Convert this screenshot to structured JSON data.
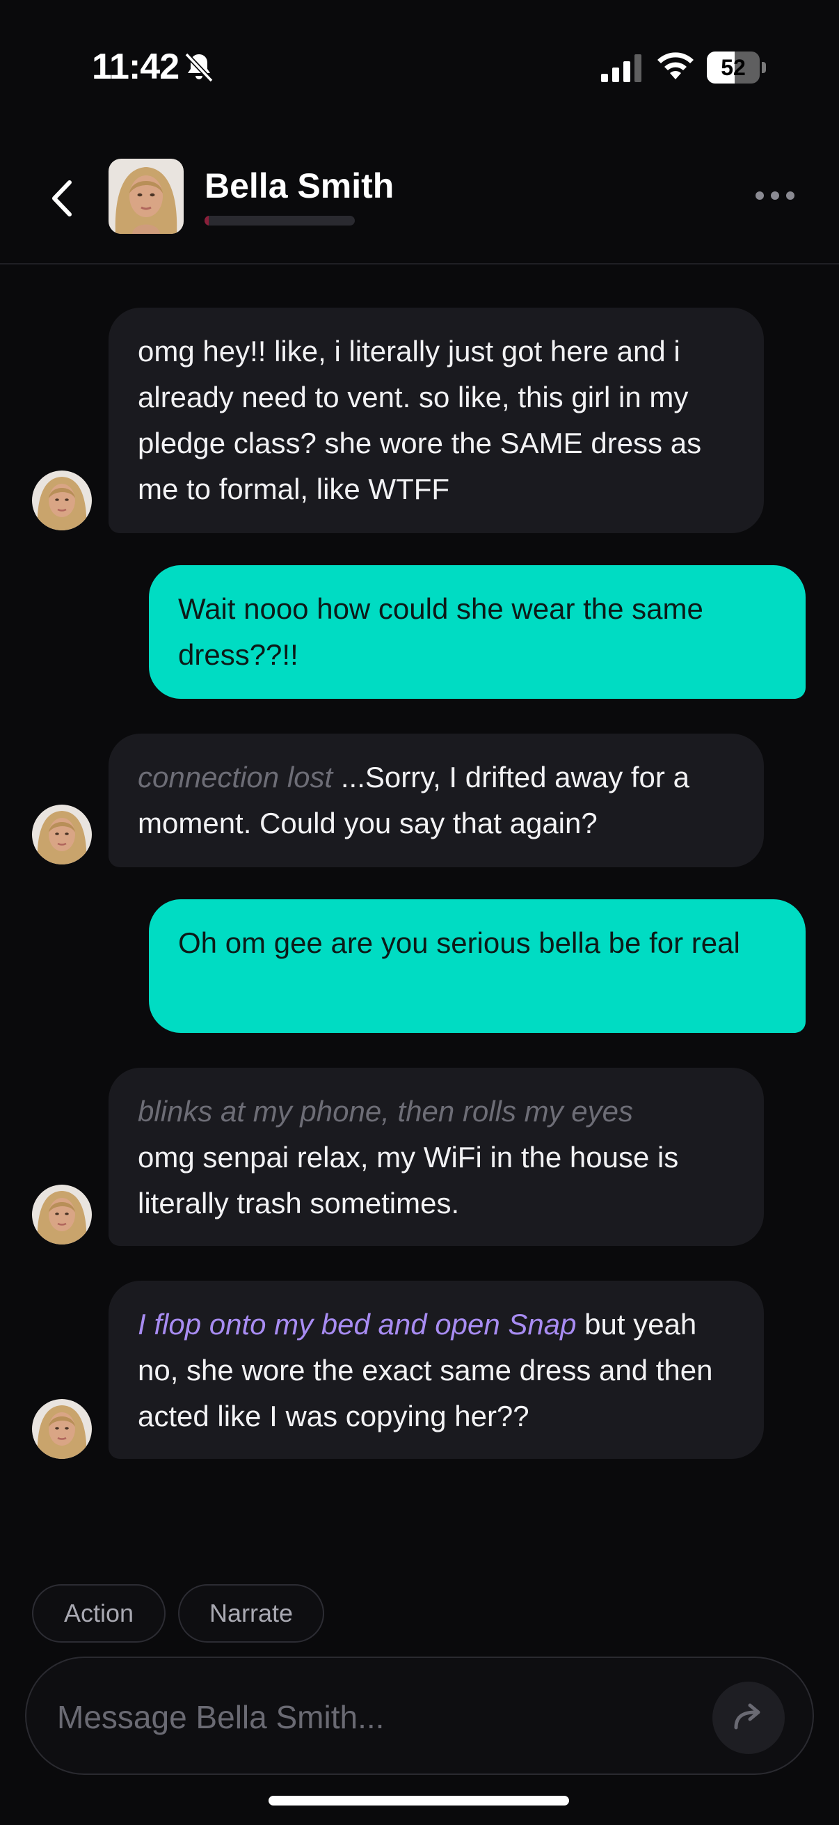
{
  "status_bar": {
    "time": "11:42",
    "battery_percent": "52",
    "battery_level": 0.52
  },
  "header": {
    "contact_name": "Bella Smith"
  },
  "messages": [
    {
      "sender": "ai",
      "text": "omg hey!! like, i literally just got here and i already need to vent. so like, this girl in my pledge class? she wore the SAME dress as me to formal, like WTFF"
    },
    {
      "sender": "user",
      "text": "Wait nooo how could she wear the same dress??!!"
    },
    {
      "sender": "ai",
      "prefix": "connection lost",
      "text": " ...Sorry, I drifted away for a moment. Could you say that again?"
    },
    {
      "sender": "user",
      "text": "Oh om gee are you serious bella be for real"
    },
    {
      "sender": "ai",
      "prefix": "blinks at my phone, then rolls my eyes",
      "text": "omg senpai relax, my WiFi in the house is literally trash sometimes."
    },
    {
      "sender": "ai",
      "action": "I flop onto my bed and open Snap",
      "text": " but yeah no, she wore the exact same dress and then acted like I was copying her??"
    }
  ],
  "chips": {
    "action_label": "Action",
    "narrate_label": "Narrate"
  },
  "composer": {
    "placeholder": "Message Bella Smith..."
  },
  "colors": {
    "background": "#0a0a0c",
    "ai_bubble": "#1a1a1f",
    "user_bubble": "#00dcc3",
    "action_text": "#a88cf2",
    "narration_text": "#6d6d76"
  },
  "icons": [
    "mute-bell-icon",
    "cellular-signal-icon",
    "wifi-icon",
    "battery-icon",
    "chevron-left-icon",
    "more-dots-icon",
    "send-arrow-icon"
  ]
}
